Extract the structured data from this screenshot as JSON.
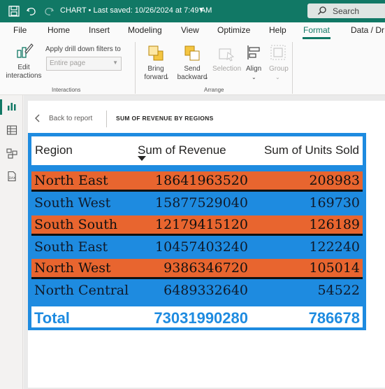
{
  "titlebar": {
    "title": "CHART • Last saved: 10/26/2024 at 7:49 AM",
    "search_placeholder": "Search"
  },
  "menu": {
    "items": [
      "File",
      "Home",
      "Insert",
      "Modeling",
      "View",
      "Optimize",
      "Help",
      "Format",
      "Data / Dr"
    ],
    "active": "Format"
  },
  "ribbon": {
    "edit_interactions": "Edit\ninteractions",
    "drill_label": "Apply drill down filters to",
    "drill_value": "Entire page",
    "interactions_group": "Interactions",
    "bring_forward": "Bring\nforward",
    "send_backward": "Send\nbackward",
    "selection": "Selection",
    "align": "Align",
    "group": "Group",
    "arrange_group": "Arrange"
  },
  "report": {
    "back_label": "Back to report",
    "visual_title": "SUM OF REVENUE BY REGIONS"
  },
  "table": {
    "columns": [
      "Region",
      "Sum of Revenue",
      "Sum of Units Sold"
    ],
    "sort_column": "Sum of Revenue",
    "sort_direction": "descending",
    "rows": [
      {
        "region": "North East",
        "revenue": "18641963520",
        "units": "208983"
      },
      {
        "region": "South West",
        "revenue": "15877529040",
        "units": "169730"
      },
      {
        "region": "South South",
        "revenue": "12179415120",
        "units": "126189"
      },
      {
        "region": "South East",
        "revenue": "10457403240",
        "units": "122240"
      },
      {
        "region": "North West",
        "revenue": "9386346720",
        "units": "105014"
      },
      {
        "region": "North Central",
        "revenue": "6489332640",
        "units": "54522"
      }
    ],
    "total": {
      "label": "Total",
      "revenue": "73031990280",
      "units": "786678"
    }
  },
  "colors": {
    "accent": "#117865",
    "orange_row": "#e8652f",
    "blue_row": "#1e8be0"
  }
}
